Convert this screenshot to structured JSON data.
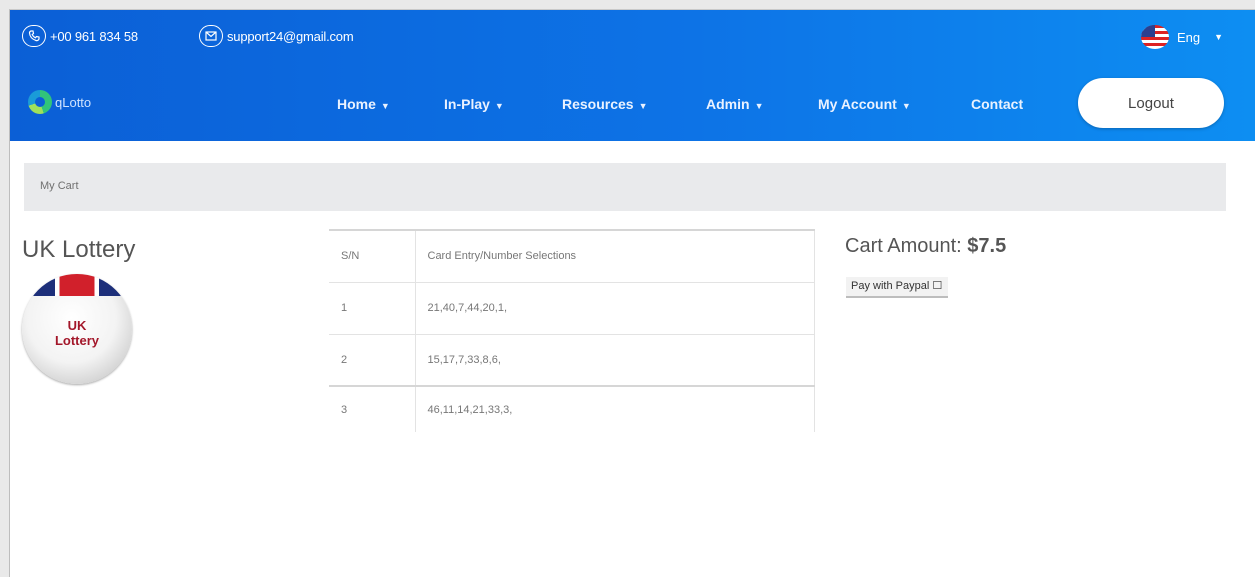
{
  "topbar": {
    "phone": "+00 961 834 58",
    "email": "support24@gmail.com",
    "language": "Eng"
  },
  "brand": {
    "name": "qLotto"
  },
  "nav": {
    "items": [
      {
        "label": "Home",
        "has_dropdown": true
      },
      {
        "label": "In-Play",
        "has_dropdown": true
      },
      {
        "label": "Resources",
        "has_dropdown": true
      },
      {
        "label": "Admin",
        "has_dropdown": true
      },
      {
        "label": "My Account",
        "has_dropdown": true
      },
      {
        "label": "Contact",
        "has_dropdown": false
      }
    ],
    "logout_label": "Logout"
  },
  "breadcrumb": {
    "current": "My Cart"
  },
  "product": {
    "title": "UK Lottery",
    "badge_text_line1": "UK",
    "badge_text_line2": "Lottery"
  },
  "cart_table": {
    "headers": [
      "S/N",
      "Card Entry/Number Selections"
    ],
    "rows": [
      {
        "sn": "1",
        "selection": "21,40,7,44,20,1,"
      },
      {
        "sn": "2",
        "selection": "15,17,7,33,8,6,"
      },
      {
        "sn": "3",
        "selection": "46,11,14,21,33,3,"
      }
    ]
  },
  "summary": {
    "cart_amount_label": "Cart Amount:",
    "cart_amount_value": "$7.5",
    "pay_button_label": "Pay with Paypal"
  },
  "colors": {
    "header_start": "#0b5fd6",
    "header_end": "#0d8ef2",
    "breadcrumb_bg": "#e9eaec"
  }
}
